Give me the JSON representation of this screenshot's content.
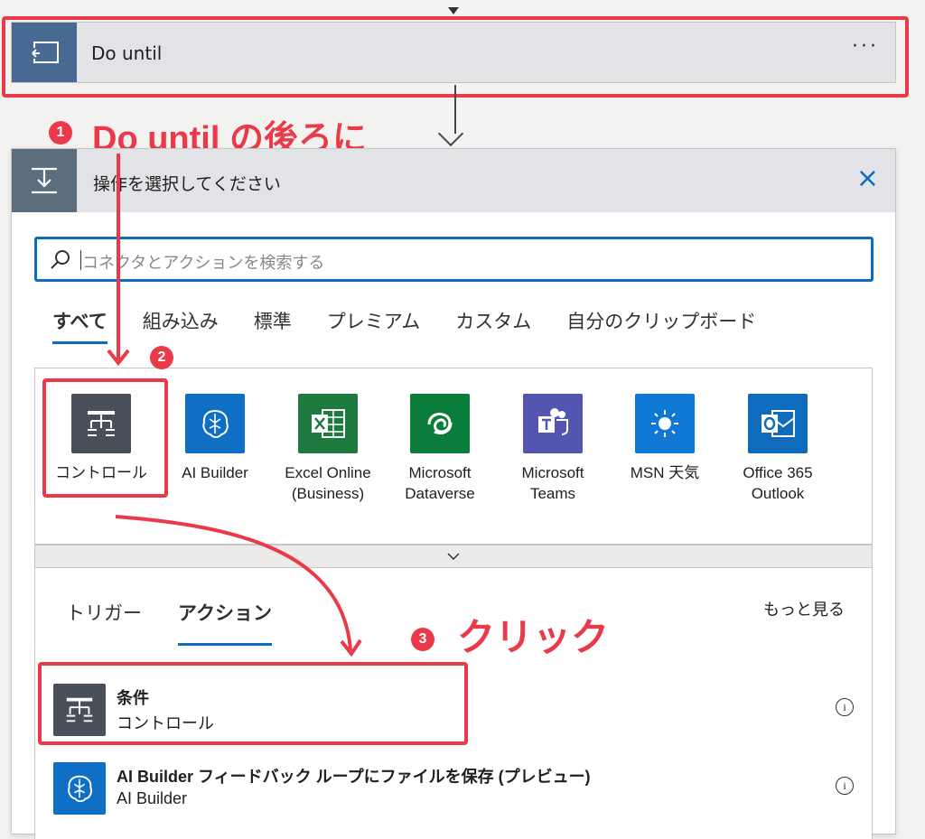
{
  "do_until": {
    "title": "Do until",
    "more": "···"
  },
  "annotations": {
    "step1_badge": "1",
    "step1_text": "Do until の後ろに",
    "step2_badge": "2",
    "step3_badge": "3",
    "step3_text": "クリック"
  },
  "panel": {
    "title": "操作を選択してください",
    "close": "×",
    "search": {
      "placeholder": "コネクタとアクションを検索する"
    },
    "tabs": [
      "すべて",
      "組み込み",
      "標準",
      "プレミアム",
      "カスタム",
      "自分のクリップボード"
    ],
    "active_tab": "すべて",
    "connectors": [
      {
        "label": "コントロール",
        "icon": "control-icon",
        "color": "#484f58"
      },
      {
        "label": "AI Builder",
        "icon": "ai-builder-icon",
        "color": "#0f6fc4"
      },
      {
        "label": "Excel Online (Business)",
        "icon": "excel-icon",
        "color": "#1f7a3f"
      },
      {
        "label": "Microsoft Dataverse",
        "icon": "dataverse-icon",
        "color": "#0b7d3b"
      },
      {
        "label": "Microsoft Teams",
        "icon": "teams-icon",
        "color": "#5256b0"
      },
      {
        "label": "MSN 天気",
        "icon": "weather-sun-icon",
        "color": "#0f78d4"
      },
      {
        "label": "Office 365 Outlook",
        "icon": "outlook-icon",
        "color": "#0f6cbd"
      }
    ],
    "subtabs": [
      "トリガー",
      "アクション"
    ],
    "active_subtab": "アクション",
    "see_more": "もっと見る",
    "actions": [
      {
        "name": "条件",
        "connector": "コントロール",
        "icon": "control-icon",
        "color": "#484f58"
      },
      {
        "name": "AI Builder フィードバック ループにファイルを保存 (プレビュー)",
        "connector": "AI Builder",
        "icon": "ai-builder-icon",
        "color": "#0f6fc4"
      }
    ]
  }
}
